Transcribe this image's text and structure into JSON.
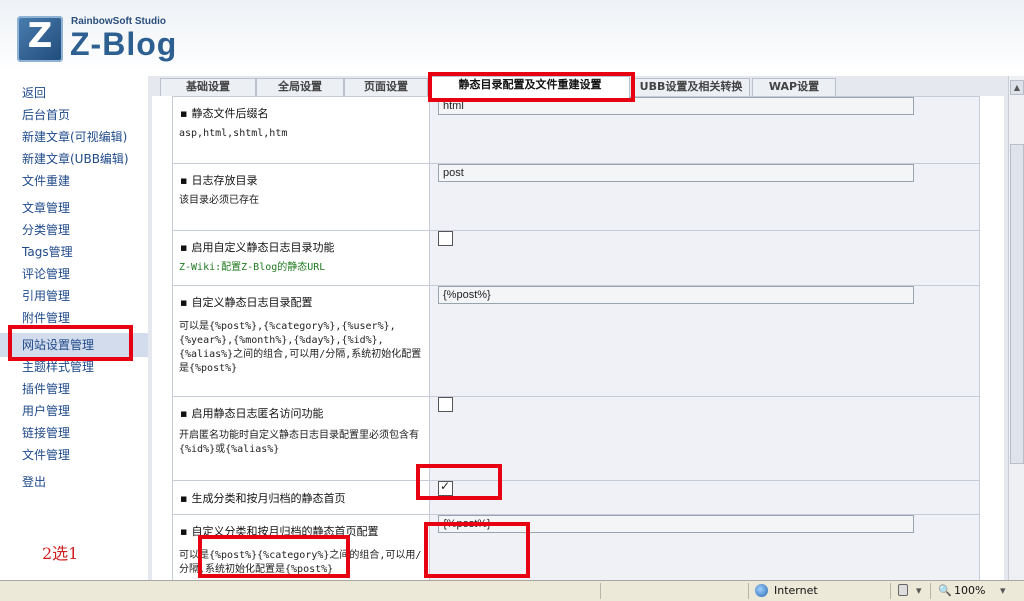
{
  "header": {
    "studio": "RainbowSoft Studio",
    "brand": "Z-Blog",
    "logo_letter": "Z"
  },
  "sidebar": {
    "items": [
      {
        "label": "返回"
      },
      {
        "label": "后台首页"
      },
      {
        "label": "新建文章(可视编辑)"
      },
      {
        "label": "新建文章(UBB编辑)"
      },
      {
        "label": "文件重建"
      },
      {
        "label": "文章管理"
      },
      {
        "label": "分类管理"
      },
      {
        "label": "Tags管理"
      },
      {
        "label": "评论管理"
      },
      {
        "label": "引用管理"
      },
      {
        "label": "附件管理"
      },
      {
        "label": "网站设置管理"
      },
      {
        "label": "主题样式管理"
      },
      {
        "label": "插件管理"
      },
      {
        "label": "用户管理"
      },
      {
        "label": "链接管理"
      },
      {
        "label": "文件管理"
      },
      {
        "label": "登出"
      }
    ],
    "active_index": 11
  },
  "annotation": {
    "note": "2选1",
    "highlight_color": "#e60012"
  },
  "tabs": [
    {
      "label": "基础设置"
    },
    {
      "label": "全局设置"
    },
    {
      "label": "页面设置"
    },
    {
      "label": "静态目录配置及文件重建设置",
      "active": true
    },
    {
      "label": "UBB设置及相关转换"
    },
    {
      "label": "WAP设置"
    }
  ],
  "settings": {
    "rows": [
      {
        "title": "静态文件后缀名",
        "desc": "asp,html,shtml,htm",
        "control": "text",
        "value": "html"
      },
      {
        "title": "日志存放目录",
        "desc": "该目录必须已存在",
        "control": "text",
        "value": "post"
      },
      {
        "title": "启用自定义静态日志目录功能",
        "desc": "Z-Wiki:配置Z-Blog的静态URL",
        "control": "checkbox",
        "checked": false
      },
      {
        "title": "自定义静态日志目录配置",
        "desc": "可以是{%post%},{%category%},{%user%},{%year%},{%month%},{%day%},{%id%},{%alias%}之间的组合,可以用/分隔,系统初始化配置是{%post%}",
        "control": "text",
        "value": "{%post%}"
      },
      {
        "title": "启用静态日志匿名访问功能",
        "desc": "开启匿名功能时自定义静态日志目录配置里必须包含有{%id%}或{%alias%}",
        "control": "checkbox",
        "checked": false
      },
      {
        "title": "生成分类和按月归档的静态首页",
        "desc": "",
        "control": "checkbox",
        "checked": true
      },
      {
        "title": "自定义分类和按月归档的静态首页配置",
        "desc": "可以是{%post%}{%category%}之间的组合,可以用/分隔,系统初始化配置是{%post%}",
        "control": "text",
        "value": "{%post%}"
      }
    ]
  },
  "statusbar": {
    "zone": "Internet",
    "zoom": "100%"
  }
}
